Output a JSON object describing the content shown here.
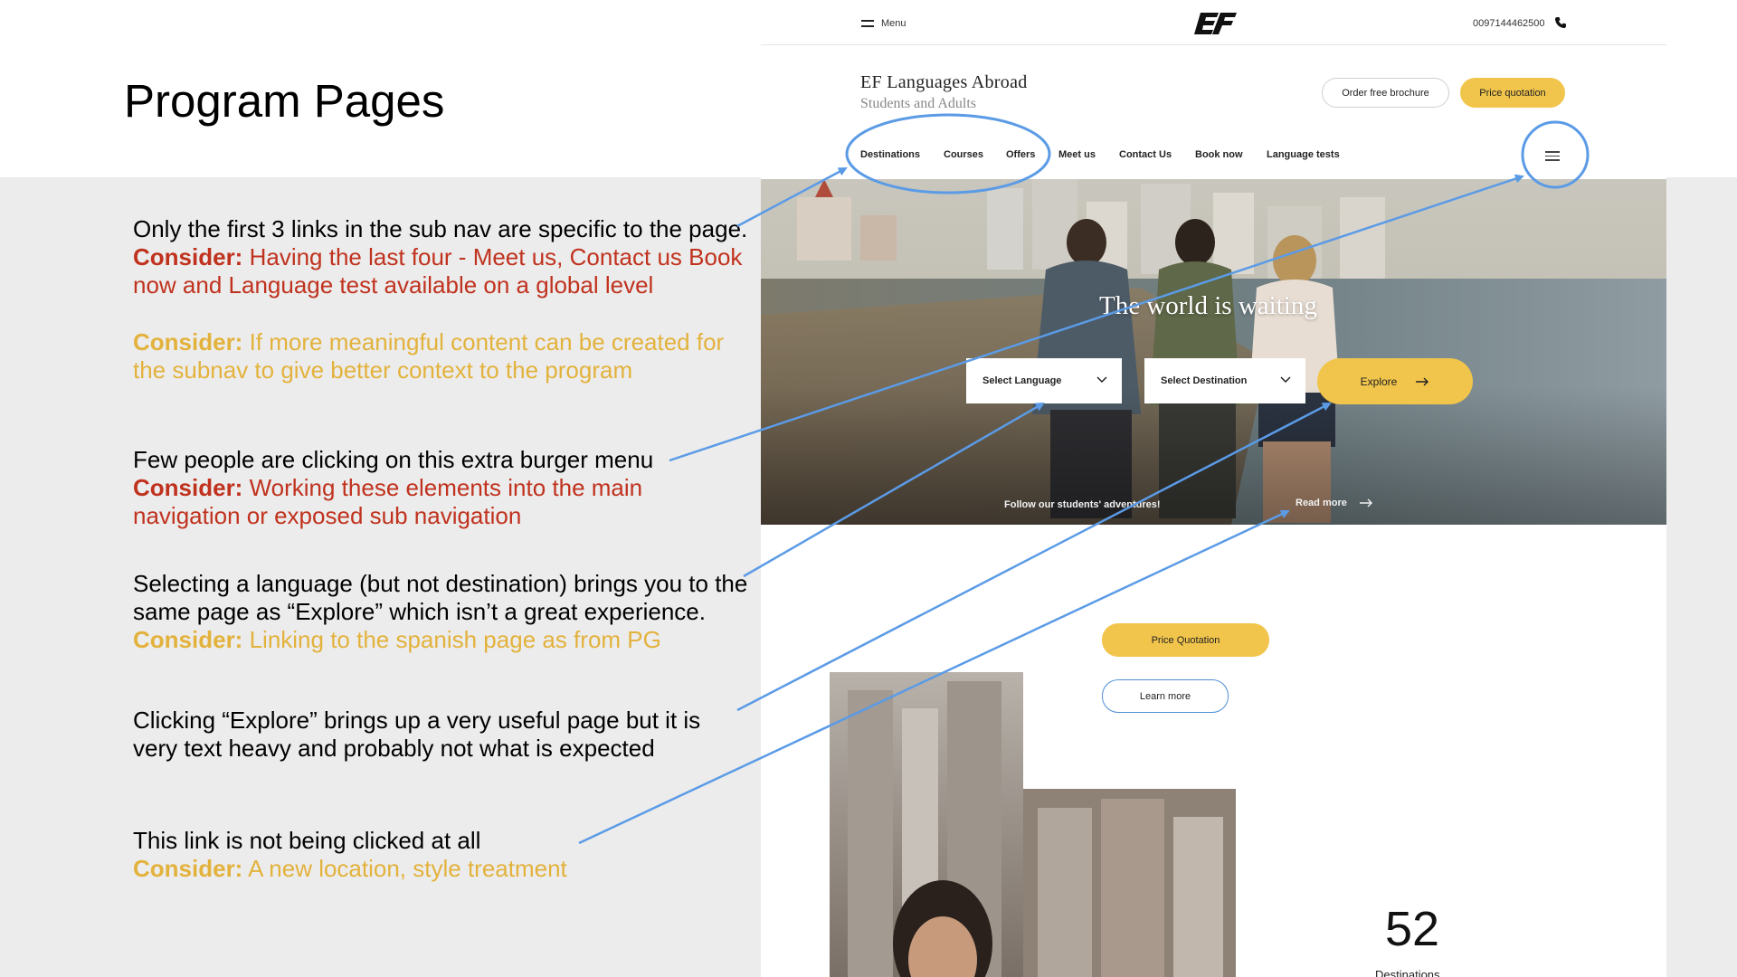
{
  "slide": {
    "title": "Program Pages"
  },
  "notes": [
    {
      "main": "Only the first 3 links in the sub nav are specific to the page.",
      "considerations": [
        {
          "label": "Consider:",
          "text": "Having the last four - Meet us, Contact us Book now and Language test available on a global level",
          "tone": "red"
        },
        {
          "label": "Consider:",
          "text": "If more meaningful content can be created for the subnav to give better context to the program",
          "tone": "gold"
        }
      ]
    },
    {
      "main": "Few people are clicking on this extra burger menu",
      "considerations": [
        {
          "label": "Consider:",
          "text": "Working these elements into the main navigation or exposed sub navigation",
          "tone": "red"
        }
      ]
    },
    {
      "main": "Selecting a language (but not destination) brings you to the same page as “Explore” which isn’t a great experience.",
      "considerations": [
        {
          "label": "Consider:",
          "text": "Linking to the spanish page as from PG",
          "tone": "gold"
        }
      ]
    },
    {
      "main": "Clicking “Explore” brings up a very useful page but it is very text heavy and probably  not what is expected",
      "considerations": []
    },
    {
      "main": "This link is not being clicked at all",
      "considerations": [
        {
          "label": "Consider:",
          "text": "A new location, style treatment",
          "tone": "gold"
        }
      ]
    }
  ],
  "site": {
    "topbar": {
      "menu_label": "Menu",
      "phone": "0097144462500"
    },
    "brand": {
      "title": "EF Languages Abroad",
      "subtitle": "Students and Adults"
    },
    "header_buttons": {
      "brochure": "Order free brochure",
      "quotation": "Price quotation"
    },
    "subnav": [
      "Destinations",
      "Courses",
      "Offers",
      "Meet us",
      "Contact Us",
      "Book now",
      "Language tests"
    ],
    "hero": {
      "headline": "The world is waiting",
      "language_select": "Select Language",
      "destination_select": "Select Destination",
      "explore": "Explore",
      "follow": "Follow our students' adventures!",
      "read_more": "Read more"
    },
    "cta": {
      "price_quotation": "Price Quotation",
      "learn_more": "Learn more"
    },
    "stat": {
      "number": "52",
      "label": "Destinations"
    }
  },
  "colors": {
    "annotation_red": "#c0321e",
    "annotation_gold": "#e3b23c",
    "accent_yellow": "#f1c54c",
    "callout_blue": "#5b9be6",
    "panel_gray": "#ececec"
  }
}
